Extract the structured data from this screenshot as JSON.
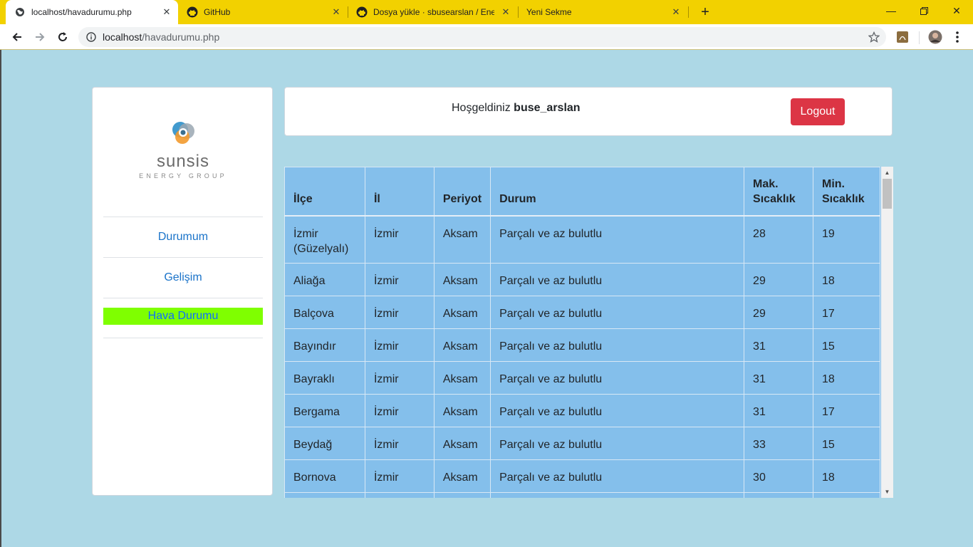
{
  "browser": {
    "tabs": [
      {
        "title": "localhost/havadurumu.php",
        "icon": "globe-icon"
      },
      {
        "title": "GitHub",
        "icon": "github-icon"
      },
      {
        "title": "Dosya yükle · sbusearslan / Enerji",
        "icon": "github-icon"
      },
      {
        "title": "Yeni Sekme",
        "icon": "none"
      }
    ],
    "url_host": "localhost",
    "url_path": "/havadurumu.php"
  },
  "sidebar": {
    "logo_name": "sunsis",
    "logo_tagline": "ENERGY GROUP",
    "items": [
      {
        "label": "Durumum"
      },
      {
        "label": "Gelişim"
      },
      {
        "label": "Hava Durumu"
      }
    ]
  },
  "header": {
    "greeting": "Hoşgeldiniz",
    "username": "buse_arslan",
    "logout_label": "Logout"
  },
  "weather_table": {
    "columns": [
      "İlçe",
      "İl",
      "Periyot",
      "Durum",
      "Mak. Sıcaklık",
      "Min. Sıcaklık"
    ],
    "rows": [
      [
        "İzmir (Güzelyalı)",
        "İzmir",
        "Aksam",
        "Parçalı ve az bulutlu",
        "28",
        "19"
      ],
      [
        "Aliağa",
        "İzmir",
        "Aksam",
        "Parçalı ve az bulutlu",
        "29",
        "18"
      ],
      [
        "Balçova",
        "İzmir",
        "Aksam",
        "Parçalı ve az bulutlu",
        "29",
        "17"
      ],
      [
        "Bayındır",
        "İzmir",
        "Aksam",
        "Parçalı ve az bulutlu",
        "31",
        "15"
      ],
      [
        "Bayraklı",
        "İzmir",
        "Aksam",
        "Parçalı ve az bulutlu",
        "31",
        "18"
      ],
      [
        "Bergama",
        "İzmir",
        "Aksam",
        "Parçalı ve az bulutlu",
        "31",
        "17"
      ],
      [
        "Beydağ",
        "İzmir",
        "Aksam",
        "Parçalı ve az bulutlu",
        "33",
        "15"
      ],
      [
        "Bornova",
        "İzmir",
        "Aksam",
        "Parçalı ve az bulutlu",
        "30",
        "18"
      ]
    ]
  },
  "colors": {
    "page_bg": "#add8e6",
    "tabbar_bg": "#f2d100",
    "table_bg": "#84bfeb",
    "logout_bg": "#dc3545",
    "active_nav_bg": "#7fff00",
    "link": "#1a73c9"
  }
}
